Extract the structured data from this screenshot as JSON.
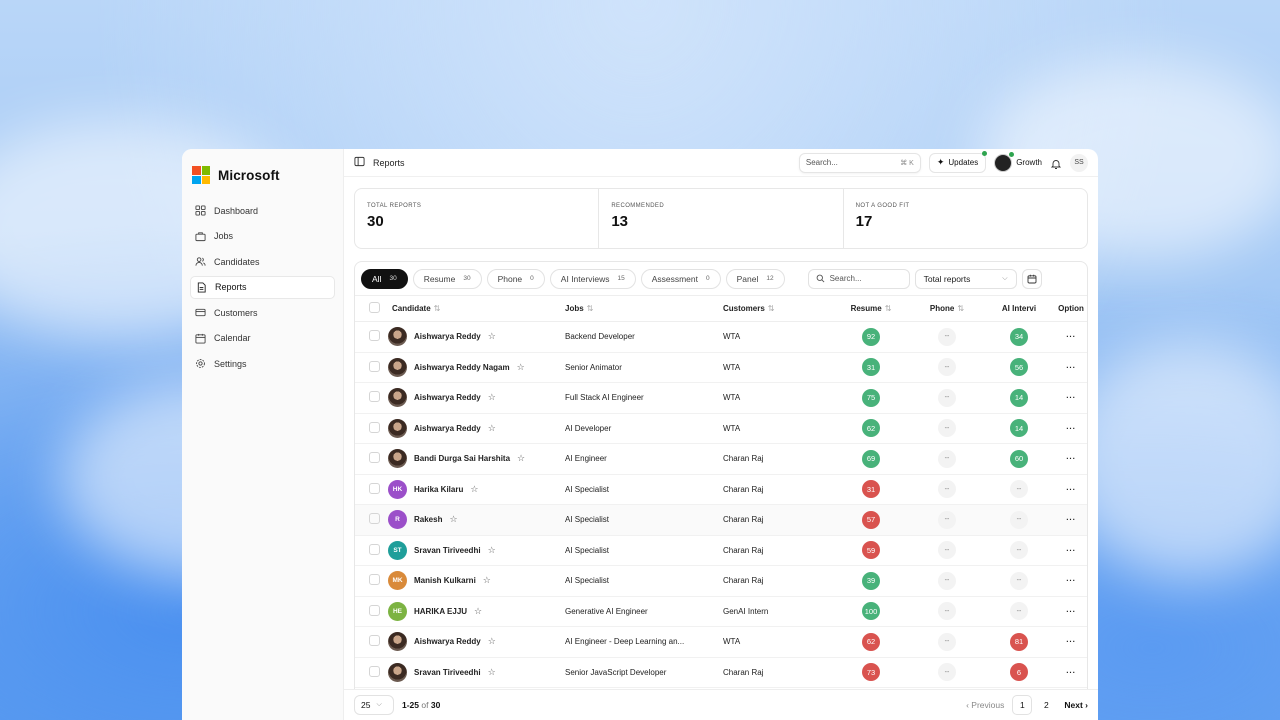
{
  "brand": {
    "name": "Microsoft",
    "logo_colors": [
      "#f25022",
      "#7fba00",
      "#00a4ef",
      "#ffb900"
    ]
  },
  "sidebar": {
    "items": [
      {
        "label": "Dashboard",
        "icon": "grid-icon"
      },
      {
        "label": "Jobs",
        "icon": "briefcase-icon"
      },
      {
        "label": "Candidates",
        "icon": "users-icon"
      },
      {
        "label": "Reports",
        "icon": "document-icon",
        "active": true
      },
      {
        "label": "Customers",
        "icon": "card-icon"
      },
      {
        "label": "Calendar",
        "icon": "calendar-icon"
      },
      {
        "label": "Settings",
        "icon": "gear-icon"
      }
    ]
  },
  "topbar": {
    "breadcrumb": "Reports",
    "search_placeholder": "Search...",
    "search_shortcut": "⌘ K",
    "updates_label": "Updates",
    "workspace_label": "Growth",
    "user_initials": "SS"
  },
  "stats": [
    {
      "label": "TOTAL REPORTS",
      "value": "30"
    },
    {
      "label": "RECOMMENDED",
      "value": "13"
    },
    {
      "label": "NOT A GOOD FIT",
      "value": "17"
    }
  ],
  "filters": {
    "tabs": [
      {
        "label": "All",
        "count": "30",
        "active": true
      },
      {
        "label": "Resume",
        "count": "30"
      },
      {
        "label": "Phone",
        "count": "0"
      },
      {
        "label": "AI Interviews",
        "count": "15"
      },
      {
        "label": "Assessment",
        "count": "0"
      },
      {
        "label": "Panel",
        "count": "12"
      }
    ],
    "search_placeholder": "Search...",
    "select_value": "Total reports"
  },
  "table": {
    "headers": {
      "candidate": "Candidate",
      "jobs": "Jobs",
      "customers": "Customers",
      "resume": "Resume",
      "phone": "Phone",
      "ai": "AI Intervi",
      "option": "Option"
    },
    "rows": [
      {
        "name": "Aishwarya Reddy",
        "avatar": "photo",
        "job": "Backend Developer",
        "customer": "WTA",
        "resume": "92",
        "resume_color": "g",
        "phone": "--",
        "ai": "34",
        "ai_color": "g"
      },
      {
        "name": "Aishwarya Reddy Nagam",
        "avatar": "photo",
        "job": "Senior Animator",
        "customer": "WTA",
        "resume": "31",
        "resume_color": "g",
        "phone": "--",
        "ai": "56",
        "ai_color": "g"
      },
      {
        "name": "Aishwarya Reddy",
        "avatar": "photo",
        "job": "Full Stack AI Engineer",
        "customer": "WTA",
        "resume": "75",
        "resume_color": "g",
        "phone": "--",
        "ai": "14",
        "ai_color": "g"
      },
      {
        "name": "Aishwarya Reddy",
        "avatar": "photo",
        "job": "AI Developer",
        "customer": "WTA",
        "resume": "62",
        "resume_color": "g",
        "phone": "--",
        "ai": "14",
        "ai_color": "g"
      },
      {
        "name": "Bandi Durga Sai Harshita",
        "avatar": "photo",
        "job": "AI Engineer",
        "customer": "Charan Raj",
        "resume": "69",
        "resume_color": "g",
        "phone": "--",
        "ai": "60",
        "ai_color": "g"
      },
      {
        "name": "Harika Kilaru",
        "avatar": "HK",
        "avatar_color": "#9b4fc9",
        "job": "AI Specialist",
        "customer": "Charan Raj",
        "resume": "31",
        "resume_color": "r",
        "phone": "--",
        "ai": "--",
        "ai_color": "dash"
      },
      {
        "name": "Rakesh",
        "avatar": "R",
        "avatar_color": "#9b4fc9",
        "job": "AI Specialist",
        "customer": "Charan Raj",
        "resume": "57",
        "resume_color": "r",
        "phone": "--",
        "ai": "--",
        "ai_color": "dash",
        "highlight": true
      },
      {
        "name": "Sravan Tiriveedhi",
        "avatar": "ST",
        "avatar_color": "#1f9e9a",
        "job": "AI Specialist",
        "customer": "Charan Raj",
        "resume": "59",
        "resume_color": "r",
        "phone": "--",
        "ai": "--",
        "ai_color": "dash"
      },
      {
        "name": "Manish Kulkarni",
        "avatar": "MK",
        "avatar_color": "#d98a3a",
        "job": "AI Specialist",
        "customer": "Charan Raj",
        "resume": "39",
        "resume_color": "g",
        "phone": "--",
        "ai": "--",
        "ai_color": "dash"
      },
      {
        "name": "HARIKA EJJU",
        "avatar": "HE",
        "avatar_color": "#7cb342",
        "job": "Generative AI Engineer",
        "customer": "GenAI Intern",
        "resume": "100",
        "resume_color": "g",
        "phone": "--",
        "ai": "--",
        "ai_color": "dash"
      },
      {
        "name": "Aishwarya Reddy",
        "avatar": "photo",
        "job": "AI Engineer - Deep Learning an...",
        "customer": "WTA",
        "resume": "62",
        "resume_color": "r",
        "phone": "--",
        "ai": "81",
        "ai_color": "r"
      },
      {
        "name": "Sravan Tiriveedhi",
        "avatar": "photo",
        "job": "Senior JavaScript Developer",
        "customer": "Charan Raj",
        "resume": "73",
        "resume_color": "r",
        "phone": "--",
        "ai": "6",
        "ai_color": "r"
      }
    ],
    "option_label": "···"
  },
  "footer": {
    "per_page": "25",
    "range": "1-25",
    "of_label": "of",
    "total": "30",
    "prev_label": "Previous",
    "pages": [
      "1",
      "2"
    ],
    "next_label": "Next"
  }
}
